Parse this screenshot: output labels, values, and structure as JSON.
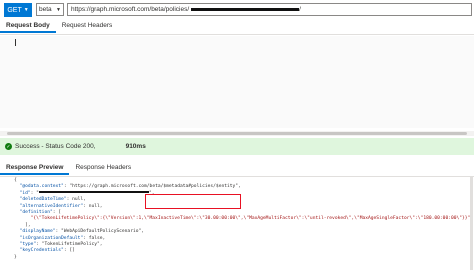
{
  "request": {
    "method": "GET",
    "version": "beta",
    "url_visible": "https://graph.microsoft.com/beta/policies/",
    "url_suffix": "/"
  },
  "request_tabs": [
    {
      "label": "Request Body",
      "active": true
    },
    {
      "label": "Request Headers",
      "active": false
    }
  ],
  "status": {
    "message": "Success - Status Code 200,",
    "duration": "910ms",
    "color": "#107c10"
  },
  "response_tabs": [
    {
      "label": "Response Preview",
      "active": true
    },
    {
      "label": "Response Headers",
      "active": false
    }
  ],
  "response_lines": [
    {
      "t": "{"
    },
    {
      "k": "\"@odata.context\"",
      "v": ": \"https://graph.microsoft.com/beta/$metadata#policies/$entity\","
    },
    {
      "k": "\"id\"",
      "v": ": \"",
      "redact": 110,
      "after": "\","
    },
    {
      "k": "\"deletedDateTime\"",
      "v": ": null,"
    },
    {
      "k": "\"alternativeIdentifier\"",
      "v": ": null,"
    },
    {
      "k": "\"definition\"",
      "v": ": ["
    },
    {
      "t": "    \"{\\\"TokenLifetimePolicy\\\":{\\\"Version\\\":1,\\\"MaxInactiveTime\\\":\\\"30.00:00:00\\\",\\\"MaxAgeMultiFactor\\\":\\\"until-revoked\\\",\\\"MaxAgeSingleFactor\\\":\\\"180.00:00:00\\\"}}\""
    },
    {
      "t": "  ],"
    },
    {
      "k": "\"displayName\"",
      "v": ": \"WebApiDefaultPolicyScenario\","
    },
    {
      "k": "\"isOrganizationDefault\"",
      "v": ": false,"
    },
    {
      "k": "\"type\"",
      "v": ": \"TokenLifetimePolicy\","
    },
    {
      "k": "\"keyCredentials\"",
      "v": ": []"
    },
    {
      "t": "}"
    }
  ],
  "colors": {
    "accent": "#0078d4",
    "status_bg": "#dff6dd",
    "highlight": "#e81123"
  }
}
